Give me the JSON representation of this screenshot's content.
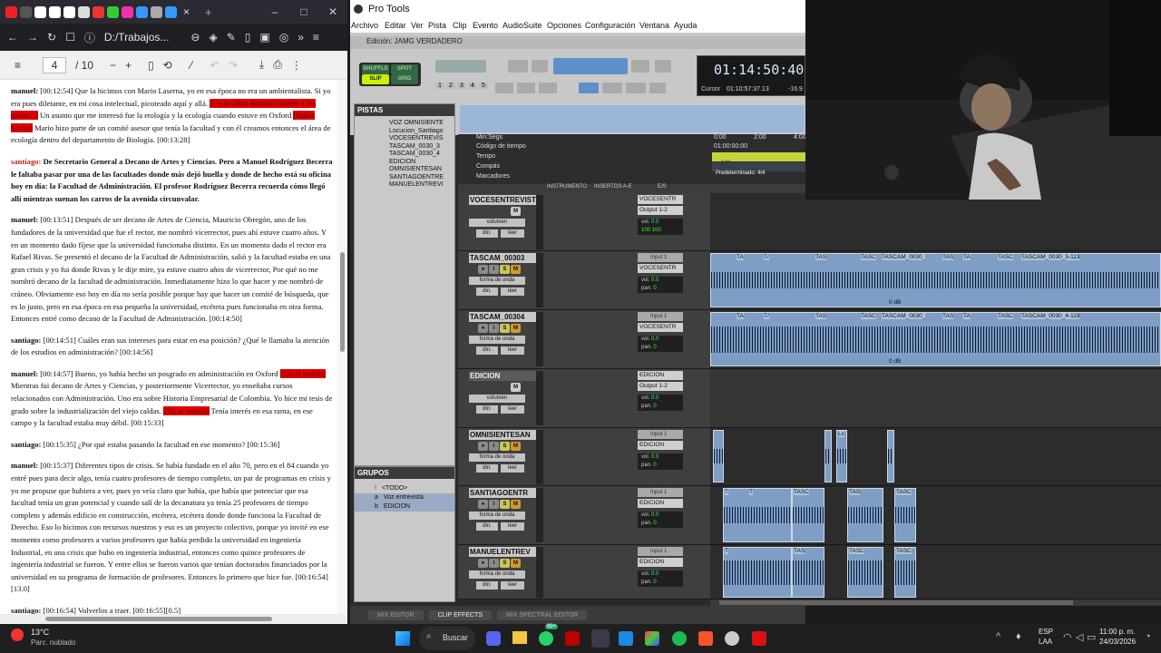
{
  "browser": {
    "tab_icon_colors": [
      "#e22",
      "#555",
      "#fff",
      "#fff",
      "#fff",
      "#ddd",
      "#e33",
      "#3c3",
      "#e3a",
      "#39f",
      "#aaa",
      "#39f"
    ],
    "tab_close": "×",
    "tab_new": "+",
    "window_controls": [
      "–",
      "□",
      "✕"
    ],
    "url": "D:/Trabajos...",
    "page_current": "4",
    "page_total": "/ 10",
    "doc": [
      {
        "who": "manuel:",
        "text": " [00:12:54] Que la hicimos con Mario Laserna, yo en esa época no era un ambientalista. Si yo era pues diletante, en mi cosa intelectual, picoteado aquí y allá.",
        "hl": "[Un de ellos denotan cuando 1 ato ganan...]",
        "after": " Un asunto que me interesó fue la etología y la ecología cuando estuve en Oxford ",
        "hl2": "[Habla Mario]",
        "after2": " Mario hizo parte de un comité asesor que tenía la facultad y con él creamos entonces el área de ecología dentro del departamento de Biología. [00:13:28]"
      },
      {
        "who": "santiago:",
        "text": " De Secretario General a Decano de Artes y Ciencias. Pero a Manuel Rodríguez Becerra le faltaba pasar por una de las facultades donde más dejó huella y donde de hecho está su oficina hoy en día: la Facultad de Administración. El profesor Rodríguez Becerra recuerda cómo llegó allí mientras suenan los carros de la avenida circunvalar.",
        "bold": true
      },
      {
        "who": "manuel:",
        "text": " [00:13:51] Después de ser decano de Artes de Ciencia, Mauricio Obregón, uno de los fundadores de la universidad que fue el rector, me nombró vicerrector, pues ahí estuve cuatro años. Y en un momento dado fíjese que la universidad funcionaba distinto. En un momento dado el rector era Rafael Rivas. Se presentó el decano de la Facultad de Administración, salió y la facultad estaba en una gran crisis y yo fui donde Rivas y le dije mire, ya estuve cuatro años de vicerrector, Por qué no me nombró decano de la facultad de administración. Inmediatamente hizo lo que hacer y me nombró de cráneo. Obviamente eso hoy en día no sería posible porque hay que hacer un comité de búsqueda, que es lo justo, pero en esa época en esa pequeña la universidad, etcétera pues funcionaba en otra forma. Entonces entré como decano de la Facultad de Administración. [00:14:50]"
      },
      {
        "who": "santiago:",
        "text": " [00:14:51] Cuáles eran sus intereses para estar en esa posición? ¿Qué le llamaba la atención de los estudios en administración? [00:14:56]"
      },
      {
        "who": "manuel:",
        "text": " [00:14:57] Bueno, yo había hecho un posgrado en administración en Oxford ",
        "hl": "[Sin el sonido]",
        "after": " Mientras fui decano de Artes y Ciencias, y posteriormente Vicerrector, yo enseñaba cursos relacionados con Administración. Uno era sobre Historia Empresarial de Colombia. Yo hice mi tesis de grado sobre la industrialización del viejo caldas.",
        "hl2": "[Sin el sonido]",
        "after2": " Tenía interés en esa rama, en ese campo y la facultad estaba muy débil. [00:15:33]"
      },
      {
        "who": "santiago:",
        "text": " [00:15:35] ¿Por qué estaba pasando la facultad en ese momento? [00:15:36]"
      },
      {
        "who": "manuel:",
        "text": " [00:15:37] Diferentes tipos de crisis. Se había fundado en el año 70, pero en el 84 cuando yo entré pues para decir algo, tenía cuatro profesores de tiempo completo, un par de programas en crisis y yo me propuse que hubiera a ver, pues yo veía claro que había, que había que potenciar que esa facultad tenía un gran potencial y cuando salí de la decanatura ya tenía 25 profesores de tiempo completo y además edificio en construcción, etcétera, etcétera donde donde funciona la Facultad de Derecho. Eso lo hicimos con recursos nuestros y eso es un proyecto colectivo, porque yo invité en ese momento como profesores a varios profesores que había perdido la universidad en ingeniería Industrial, en una crisis que hubo en ingeniería industrial, entonces como quince profesores de ingeniería industrial se fueron. Y entre ellos se fueron varios que tenían doctorados financiados por la universidad en su programa de formación de profesores. Entonces lo primero que hice fue. [00:16:54][13.0]"
      },
      {
        "who": "santiago:",
        "text": " [00:16:54] Volverlos a traer. [00:16:55][0.5]"
      }
    ]
  },
  "protools": {
    "app_title": "Pro Tools",
    "menu": [
      "Archivo",
      "Editar",
      "Ver",
      "Pista",
      "Clip",
      "Evento",
      "AudioSuite",
      "Opciones",
      "Configuración",
      "Ventana",
      "Ayuda"
    ],
    "edit_title": "Edición: JAMG VERDADERO",
    "modes": [
      "SHUFFLE",
      "SPOT",
      "SLIP",
      "GRID"
    ],
    "zoom_presets": [
      "1",
      "2",
      "3",
      "4",
      "5"
    ],
    "counter": "01:14:50:40",
    "cursor_label": "Cursor",
    "cursor_value": "01:10:57:37.13",
    "cursor_extra": "-16.9",
    "tracks_panel_title": "PISTAS",
    "tracks_list": [
      "VOZ OMNISIENTE",
      "Locucion_Santiago",
      "VOCESENTREVIS",
      "TASCAM_0030_3",
      "TASCAM_0030_4",
      "EDICION",
      "OMNISIENTESAN",
      "SANTIAGOENTRE",
      "MANUELENTREVI"
    ],
    "groups_panel_title": "GRUPOS",
    "groups": [
      {
        "id": "!",
        "name": "<TODO>"
      },
      {
        "id": "a",
        "name": "Voz entrevista"
      },
      {
        "id": "b",
        "name": "EDICION"
      }
    ],
    "ruler": {
      "minsegs": "Min:Segs",
      "timecode": "Código de tiempo",
      "tempo": "Tempo",
      "compas": "Compás",
      "marcadores": "Marcadores",
      "ticks": [
        "0:00",
        "2:00",
        "4:00"
      ],
      "tc_value": "01:00:00:00",
      "tempo_value": "120",
      "meter_value": "Predeterminado: 4/4"
    },
    "columns": [
      "INSTRUMENTO",
      "INSERTOS A-E",
      "E/S"
    ],
    "tracks": [
      {
        "name": "VOCESENTREVIST",
        "mode": "volumen",
        "in": "VOCESENTR",
        "out": "Output 1-2",
        "vol": "0.0",
        "pan": "100  100",
        "lane_clips": []
      },
      {
        "name": "TASCAM_00303",
        "mode": "forma de onda",
        "in": "Input 1",
        "out": "VOCESENTR",
        "vol": "0.0",
        "pan": "0",
        "lane_clips": [
          {
            "l": "TA"
          },
          {
            "l": "T"
          },
          {
            "l": "TA"
          },
          {
            "l": "T/"
          },
          {
            "l": "TAS"
          },
          {
            "l": "TASC"
          },
          {
            "l": "TASCAM_0030_"
          },
          {
            "l": "TAS"
          },
          {
            "l": "TA"
          },
          {
            "l": "TASC"
          },
          {
            "l": "TASCAM_0030_3-113"
          }
        ],
        "fade": "0 dB"
      },
      {
        "name": "TASCAM_00304",
        "mode": "forma de onda",
        "in": "Input 1",
        "out": "VOCESENTR",
        "vol": "0.0",
        "pan": "0",
        "lane_clips": [
          {
            "l": "TA"
          },
          {
            "l": "T"
          },
          {
            "l": "TA"
          },
          {
            "l": "T/"
          },
          {
            "l": "TAS"
          },
          {
            "l": "TASC"
          },
          {
            "l": "TASCAM_0030_"
          },
          {
            "l": "TAS"
          },
          {
            "l": "TA"
          },
          {
            "l": "TASC"
          },
          {
            "l": "TASCAM_0030_4-119"
          }
        ],
        "fade": "0 dB"
      },
      {
        "name": "EDICION",
        "mode": "volumen",
        "in": "EDICION",
        "out": "Output 1-2",
        "vol": "0.0",
        "pan": "0",
        "lane_clips": []
      },
      {
        "name": "OMNISIENTESAN",
        "mode": "forma de onda",
        "in": "Input 1",
        "out": "EDICION",
        "vol": "0.0",
        "pan": "0",
        "lane_clips": [
          {
            "l": "Lc"
          }
        ]
      },
      {
        "name": "SANTIAGOENTR",
        "mode": "forma de onda",
        "in": "Input 1",
        "out": "EDICION",
        "vol": "0.0",
        "pan": "0",
        "lane_clips": [
          {
            "l": "T"
          },
          {
            "l": "T"
          },
          {
            "l": "TASC"
          },
          {
            "l": "TAS"
          },
          {
            "l": "TASC"
          }
        ]
      },
      {
        "name": "MANUELENTREV",
        "mode": "forma de onda",
        "in": "Input 1",
        "out": "EDICION",
        "vol": "0.0",
        "pan": "0",
        "lane_clips": [
          {
            "l": "T"
          },
          {
            "l": "TAS"
          },
          {
            "l": "TASC"
          },
          {
            "l": "TASC"
          }
        ]
      }
    ],
    "bottom_tabs": [
      "MIX EDITOR",
      "CLIP EFFECTS",
      "MIX SPECTRAL EDITOR"
    ],
    "labels": {
      "dyn": "din.",
      "read": "leer",
      "vol": "vol.",
      "pan": "pan."
    }
  },
  "taskbar": {
    "weather_temp": "13°C",
    "weather_desc": "Parc. nublado",
    "search": "Buscar",
    "lang": "ESP",
    "lang2": "LAA",
    "time": "11:00 p. m.",
    "date": "24/03/2026",
    "badge": "99+"
  }
}
